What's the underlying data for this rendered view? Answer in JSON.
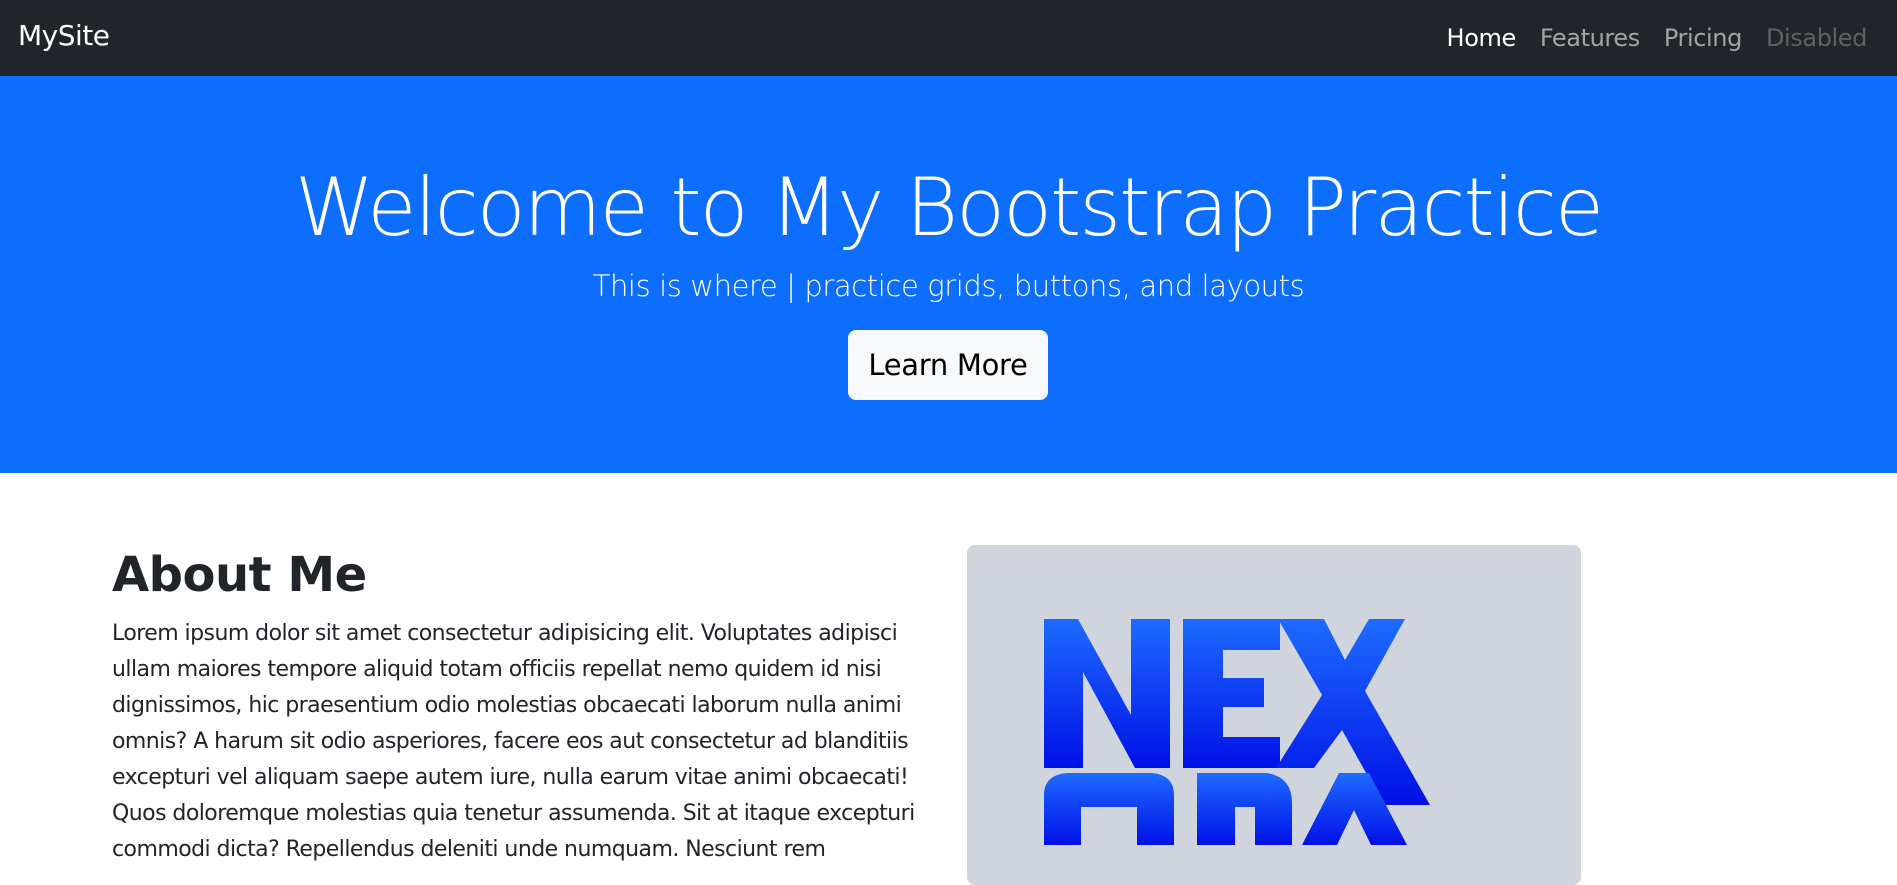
{
  "navbar": {
    "brand": "MySite",
    "links": [
      {
        "label": "Home"
      },
      {
        "label": "Features"
      },
      {
        "label": "Pricing"
      },
      {
        "label": "Disabled"
      }
    ]
  },
  "hero": {
    "title": "Welcome to My Bootstrap Practice",
    "subtitle": "This is where | practice grids, buttons, and layouts",
    "button_label": "Learn More"
  },
  "about": {
    "title": "About Me",
    "text": "Lorem ipsum dolor sit amet consectetur adipisicing elit. Voluptates adipisci ullam maiores tempore aliquid totam officiis repellat nemo quidem id nisi dignissimos, hic praesentium odio molestias obcaecati laborum nulla animi omnis? A harum sit odio asperiores, facere eos aut consectetur ad blanditiis excepturi vel aliquam saepe autem iure, nulla earum vitae animi obcaecati! Quos doloremque molestias quia tenetur assumenda. Sit at itaque excepturi commodi dicta? Repellendus deleniti unde numquam. Nesciunt rem"
  },
  "image": {
    "logo_text": "NEXORA"
  },
  "colors": {
    "navbar_bg": "#212529",
    "hero_bg": "#0d6efd",
    "card_bg": "#d0d5dd",
    "logo_gradient_top": "#1e6bff",
    "logo_gradient_bottom": "#0010e6"
  }
}
